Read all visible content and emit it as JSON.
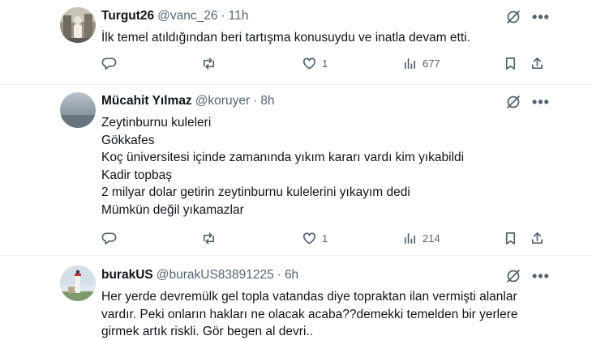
{
  "tweets": [
    {
      "name": "Turgut26",
      "handle": "@vanc_26",
      "separator": "·",
      "time": "11h",
      "lines": [
        "İlk temel atıldığından beri tartışma konusuydu ve inatla devam etti."
      ],
      "replies": "",
      "retweets": "",
      "likes": "1",
      "views": "677"
    },
    {
      "name": "Mücahit Yılmaz",
      "handle": "@koruyer",
      "separator": "·",
      "time": "8h",
      "lines": [
        "Zeytinburnu kuleleri",
        "Gökkafes",
        "Koç üniversitesi içinde zamanında yıkım kararı vardı kim yıkabildi",
        "Kadir topbaş",
        "2 milyar dolar getirin zeytinburnu kulelerini yıkayım dedi",
        "Mümkün değil yıkamazlar"
      ],
      "replies": "",
      "retweets": "",
      "likes": "1",
      "views": "214"
    },
    {
      "name": "burakUS",
      "handle": "@burakUS83891225",
      "separator": "·",
      "time": "6h",
      "lines": [
        "Her yerde devremülk gel topla vatandas diye topraktan ilan vermişti alanlar",
        "vardır. Peki onların hakları ne olacak acaba??demekki temelden bir yerlere",
        "girmek artık riskli. Gör begen al devri.."
      ]
    }
  ],
  "icons": {
    "grok": "grok-icon",
    "more": "more-icon",
    "reply": "reply-icon",
    "retweet": "retweet-icon",
    "like": "like-icon",
    "views": "views-icon",
    "bookmark": "bookmark-icon",
    "share": "share-icon"
  },
  "colors": {
    "text": "#0f1419",
    "secondary": "#536471",
    "divider": "#eff3f4"
  }
}
